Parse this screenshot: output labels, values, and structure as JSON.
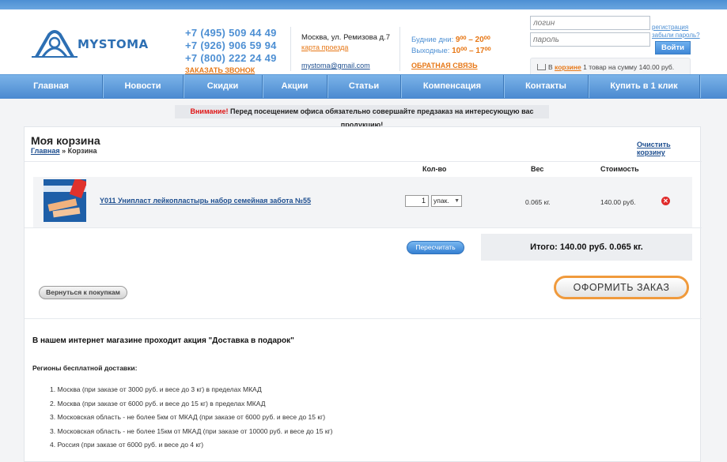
{
  "logo": {
    "text": "MYSTOMA"
  },
  "header": {
    "phones": [
      "+7 (495) 509 44 49",
      "+7 (926) 906 59 94",
      "+7 (800) 222 24 49"
    ],
    "call_me": "ЗАКАЗАТЬ ЗВОНОК",
    "address": "Москва, ул. Ремизова д.7",
    "map_link": "карта проезда",
    "email": "mystoma@gmail.com",
    "hours": {
      "weekdays_label": "Будние дни:",
      "weekdays_value": "9⁰⁰ – 20⁰⁰",
      "weekend_label": "Выходные:",
      "weekend_value": "10⁰⁰ – 17⁰⁰"
    },
    "feedback": "ОБРАТНАЯ СВЯЗЬ",
    "login_placeholder": "логин",
    "password_placeholder": "пароль",
    "register": "регистрация",
    "forgot": "забыли пароль?",
    "login_button": "Войти",
    "cart_prefix": "В",
    "cart_link": "корзине",
    "cart_summary": "1 товар на сумму 140.00 руб."
  },
  "nav": [
    {
      "label": "Главная",
      "w": 130
    },
    {
      "label": "Новости",
      "w": 102
    },
    {
      "label": "Скидки",
      "w": 100
    },
    {
      "label": "Акции",
      "w": 82
    },
    {
      "label": "Статьи",
      "w": 93
    },
    {
      "label": "Компенсация",
      "w": 130
    },
    {
      "label": "Контакты",
      "w": 107
    },
    {
      "label": "Купить в 1 клик",
      "w": 141
    }
  ],
  "notice": {
    "warning": "Внимание!",
    "text": "Перед посещением офиса обязательно совершайте предзаказ на интересующую вас продукцию!"
  },
  "cart": {
    "title": "Моя корзина",
    "breadcrumb_home": "Главная",
    "breadcrumb_sep": "»",
    "breadcrumb_current": "Корзина",
    "clear": "Очистить корзину",
    "col_qty": "Кол-во",
    "col_weight": "Вес",
    "col_cost": "Стоимость",
    "item": {
      "name": "Y011 Унипласт лейкопластырь набор семейная забота №55",
      "qty": "1",
      "unit": "упак.",
      "weight": "0.065 кг.",
      "price": "140.00 руб."
    },
    "recalc": "Пересчитать",
    "total": "Итого: 140.00 руб. 0.065 кг.",
    "back": "Вернуться к покупкам",
    "order": "ОФОРМИТЬ ЗАКАЗ"
  },
  "promo": {
    "title": "В нашем интернет магазине проходит акция \"Доставка в подарок\"",
    "regions_title": "Регионы бесплатной доставки:",
    "regions": [
      "1. Москва (при заказе от 3000 руб. и весе до 3 кг) в пределах МКАД",
      "2. Москва (при заказе от 6000 руб. и весе до 15 кг) в пределах МКАД",
      "3. Московская область - не более 5км от МКАД (при заказе от 6000 руб. и весе до 15 кг)",
      "3. Московская область - не более 15км от МКАД (при заказе от 10000 руб. и весе до 15 кг)",
      "4. Россия (при заказе от 6000 руб. и весе до 4 кг)"
    ]
  },
  "colors": {
    "brand_blue": "#4d8fd3",
    "accent_orange": "#e77817",
    "alert_red": "#e01414"
  }
}
